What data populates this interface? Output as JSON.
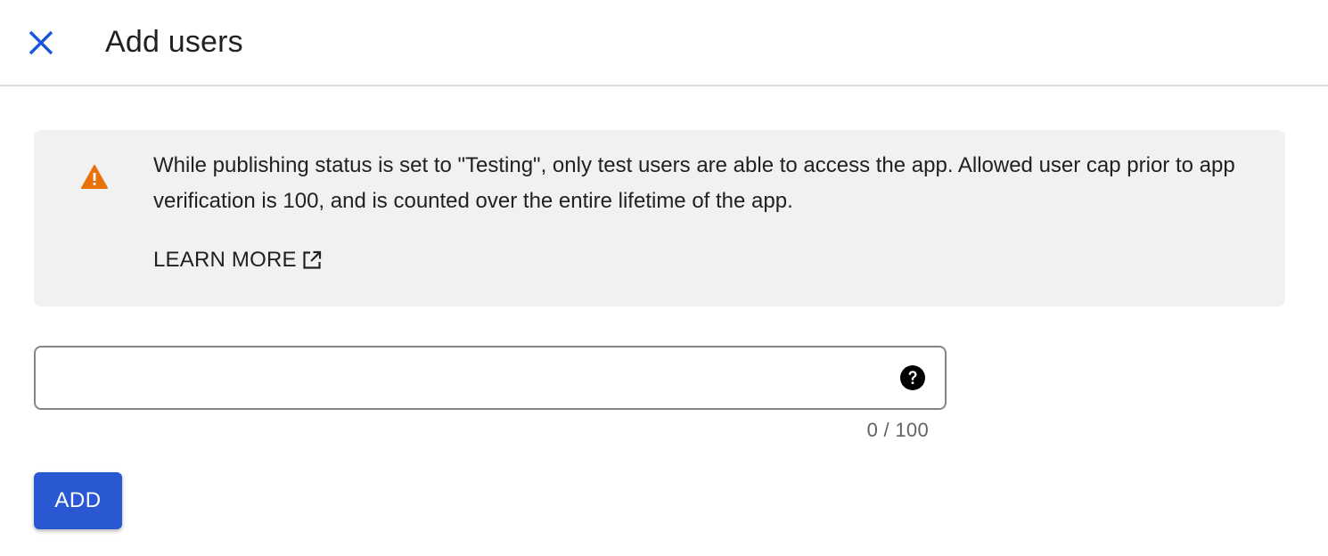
{
  "header": {
    "title": "Add users",
    "close_icon": "close-icon"
  },
  "banner": {
    "icon": "warning-icon",
    "message": "While publishing status is set to \"Testing\", only test users are able to access the app. Allowed user cap prior to app verification is 100, and is counted over the entire lifetime of the app.",
    "learn_more_label": "LEARN MORE",
    "learn_more_icon": "open-in-new-icon"
  },
  "users_input": {
    "value": "",
    "help_icon": "help-icon",
    "counter": "0 / 100"
  },
  "actions": {
    "add_label": "ADD"
  },
  "colors": {
    "accent": "#2a58d3",
    "close_icon": "#1a56db",
    "warning": "#e8710a",
    "banner_bg": "#f1f1f1"
  }
}
